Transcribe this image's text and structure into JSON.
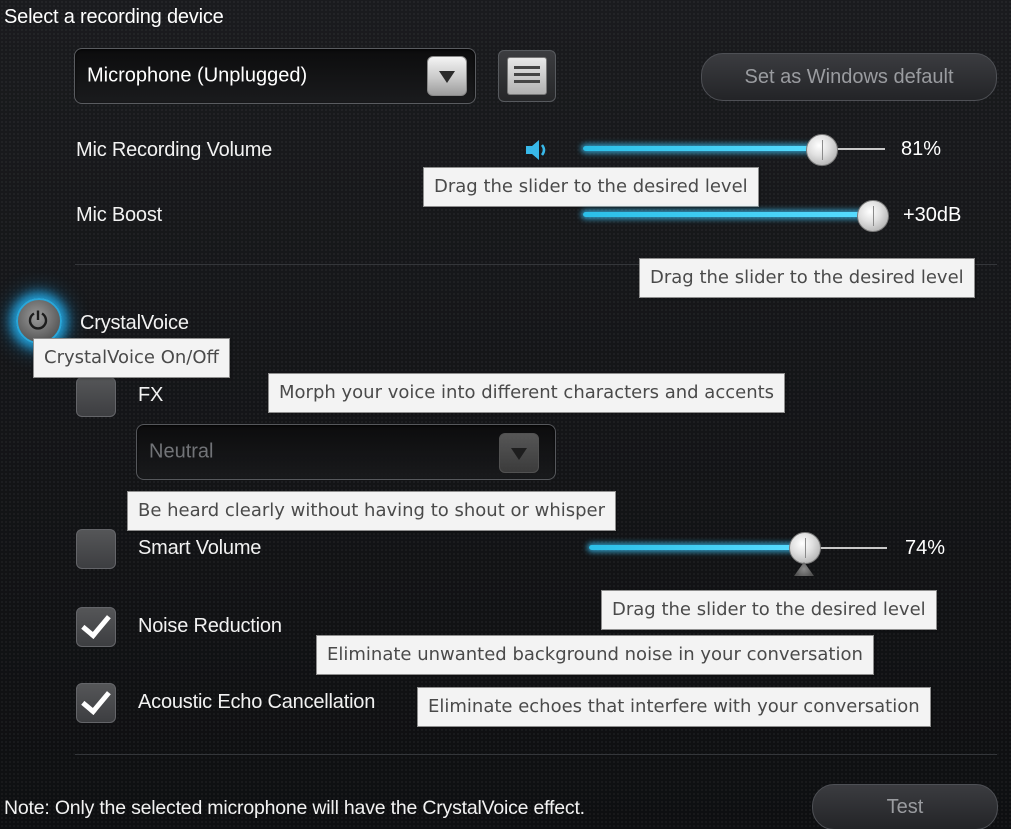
{
  "header": {
    "title": "Select a recording device"
  },
  "device": {
    "selected": "Microphone (Unplugged)"
  },
  "buttons": {
    "set_default": "Set as Windows default",
    "test": "Test"
  },
  "sliders": {
    "mic_volume": {
      "label": "Mic Recording Volume",
      "value_text": "81%",
      "level": 0.81
    },
    "mic_boost": {
      "label": "Mic Boost",
      "value_text": "+30dB",
      "level": 1.0
    },
    "smart_volume": {
      "value_text": "74%",
      "level": 0.74
    }
  },
  "crystalvoice": {
    "label": "CrystalVoice",
    "enabled": true
  },
  "fx": {
    "label": "FX",
    "checked": false,
    "preset": "Neutral"
  },
  "options": [
    {
      "label": "Smart Volume",
      "checked": false
    },
    {
      "label": "Noise Reduction",
      "checked": true
    },
    {
      "label": "Acoustic Echo Cancellation",
      "checked": true
    }
  ],
  "tooltips": {
    "drag_slider_1": "Drag the slider to the desired level",
    "drag_slider_2": "Drag the slider to the desired level",
    "crystalvoice": "CrystalVoice On/Off",
    "fx": "Morph your voice into different characters and accents",
    "smart_volume": "Be heard clearly without having to shout or whisper",
    "drag_slider_3": "Drag the slider to the desired level",
    "noise_reduction": "Eliminate unwanted background noise in your conversation",
    "echo_cancellation": "Eliminate echoes that interfere with your conversation"
  },
  "footer": {
    "note": "Note: Only the selected microphone will have the CrystalVoice effect."
  },
  "colors": {
    "accent": "#3cc8f5",
    "background": "#131416",
    "tooltip_bg": "#f3f3f3"
  },
  "icons": {
    "device_list": "list-icon",
    "speaker": "speaker-icon",
    "power": "power-icon",
    "check": "checkmark-icon",
    "dropdown": "chevron-down-icon"
  }
}
